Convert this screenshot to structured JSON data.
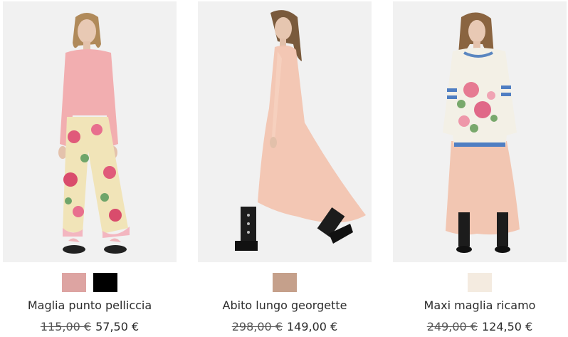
{
  "products": [
    {
      "name": "Maglia punto pelliccia",
      "old_price": "115,00 €",
      "price": "57,50 €",
      "swatches": [
        "#dda4a2",
        "#000000"
      ]
    },
    {
      "name": "Abito lungo georgette",
      "old_price": "298,00 €",
      "price": "149,00 €",
      "swatches": [
        "#c5a08b"
      ]
    },
    {
      "name": "Maxi maglia ricamo",
      "old_price": "249,00 €",
      "price": "124,50 €",
      "swatches": [
        "#f4ebe0"
      ]
    }
  ]
}
